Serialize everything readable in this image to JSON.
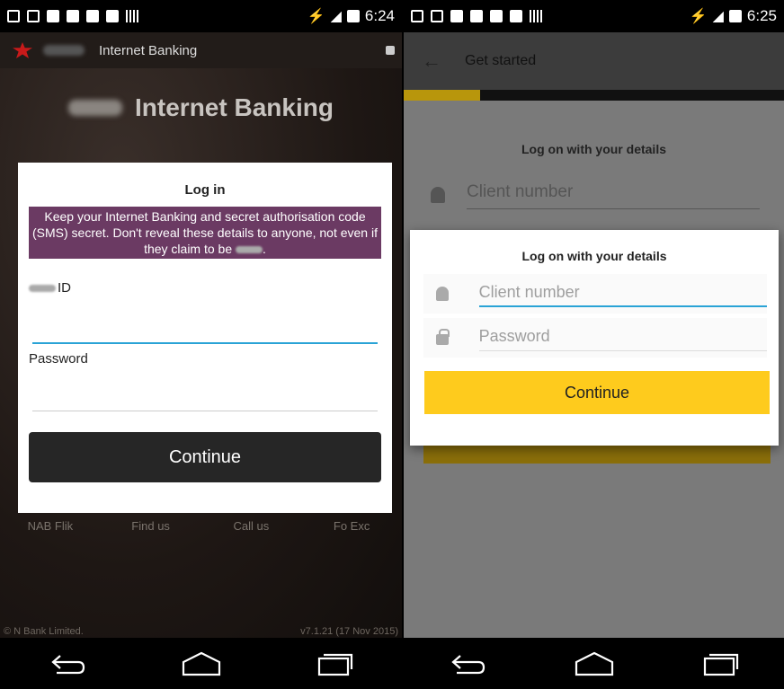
{
  "left": {
    "status": {
      "time": "6:24"
    },
    "appbar_title": "Internet Banking",
    "hero_title": "Internet Banking",
    "login": {
      "title": "Log in",
      "warning": "Keep your Internet Banking and secret authorisation code (SMS) secret. Don't reveal these details to anyone, not even if they claim to be",
      "id_label": "ID",
      "password_label": "Password",
      "continue": "Continue"
    },
    "footer_links": [
      "NAB Flik",
      "Find us",
      "Call us",
      "Fo Exc"
    ],
    "footer_left": "© N                    Bank Limited.",
    "footer_right": "v7.1.21 (17 Nov 2015)"
  },
  "right": {
    "status": {
      "time": "6:25"
    },
    "appbar_title": "Get started",
    "dim_title": "Log on with your            details",
    "dim_placeholder": "Client number",
    "dialog": {
      "title": "Log on with your            details",
      "client_placeholder": "Client number",
      "password_placeholder": "Password",
      "continue": "Continue"
    }
  },
  "icons": [
    "back-arrow-icon",
    "home-icon",
    "recents-icon",
    "lock-icon",
    "person-icon",
    "padlock-icon",
    "wifi-icon",
    "battery-icon",
    "signal-icon"
  ],
  "colors": {
    "accent_blue": "#2aa3d6",
    "yellow": "#fecb1d",
    "warning_purple": "#6b3a63",
    "button_dark": "#262626"
  }
}
